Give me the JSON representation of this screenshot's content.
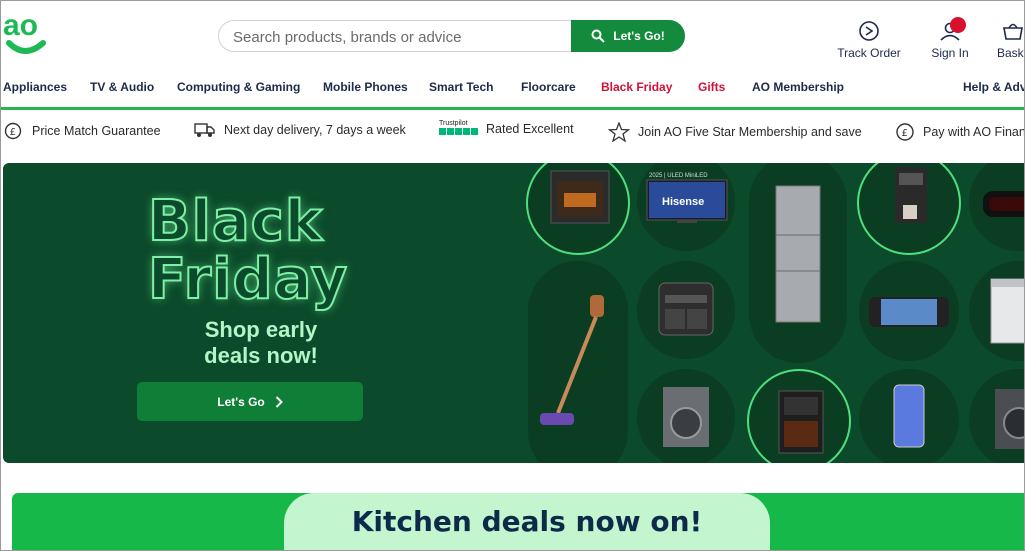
{
  "header": {
    "logo_text": "ao",
    "search_placeholder": "Search products, brands or advice",
    "search_button_label": "Let's Go!",
    "track_order": "Track Order",
    "sign_in": "Sign In",
    "basket": "Baske"
  },
  "nav": {
    "items": [
      "Appliances",
      "TV & Audio",
      "Computing & Gaming",
      "Mobile Phones",
      "Smart Tech",
      "Floorcare",
      "Black Friday",
      "Gifts",
      "AO Membership"
    ],
    "help": "Help & Advi"
  },
  "usp": {
    "price_match": "Price Match Guarantee",
    "delivery": "Next day delivery, 7 days a week",
    "trustpilot_brand": "Trustpilot",
    "rated": "Rated Excellent",
    "membership": "Join AO Five Star Membership and save",
    "finance": "Pay with AO Finan"
  },
  "hero": {
    "title_line1": "Black",
    "title_line2": "Friday",
    "subtitle_line1": "Shop early",
    "subtitle_line2": "deals now!",
    "cta": "Let's Go",
    "tv_brand": "Hisense",
    "tv_caption": "2025 | ULED MiniLED"
  },
  "promo": {
    "text": "Kitchen deals now on!"
  },
  "colors": {
    "brand_green": "#148a3c",
    "hero_bg": "#0b4a2a",
    "neon_green": "#7df0a5",
    "nav_red": "#d0103a",
    "promo_green": "#16b84a"
  }
}
